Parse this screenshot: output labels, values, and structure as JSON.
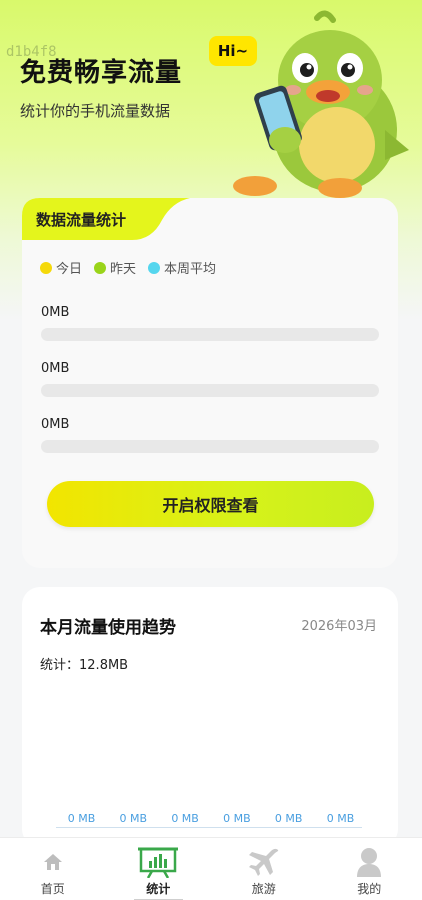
{
  "hero": {
    "watermark": "d1b4f8",
    "title": "免费畅享流量",
    "subtitle": "统计你的手机流量数据",
    "bubble": "Hi~"
  },
  "traffic_card": {
    "tab_title": "数据流量统计",
    "legend": [
      {
        "label": "今日",
        "color": "#f5d90a"
      },
      {
        "label": "昨天",
        "color": "#9ad41a"
      },
      {
        "label": "本周平均",
        "color": "#55d6ee"
      }
    ],
    "rows": [
      {
        "value": "0MB",
        "fill": 0
      },
      {
        "value": "0MB",
        "fill": 0
      },
      {
        "value": "0MB",
        "fill": 0
      }
    ],
    "button_label": "开启权限查看"
  },
  "trend_card": {
    "title": "本月流量使用趋势",
    "date": "2026年03月",
    "total_label": "统计：",
    "total_value": "12.8MB",
    "labels": [
      "0 MB",
      "0 MB",
      "0 MB",
      "0 MB",
      "0 MB",
      "0 MB"
    ]
  },
  "tabbar": {
    "items": [
      {
        "label": "首页",
        "icon": "home-icon"
      },
      {
        "label": "统计",
        "icon": "chart-board-icon"
      },
      {
        "label": "旅游",
        "icon": "airplane-icon"
      },
      {
        "label": "我的",
        "icon": "user-icon"
      }
    ],
    "active_index": 1
  },
  "colors": {
    "accent_yellow": "#f2e500",
    "accent_green": "#4caf50",
    "trend_label": "#4a9fe0"
  }
}
